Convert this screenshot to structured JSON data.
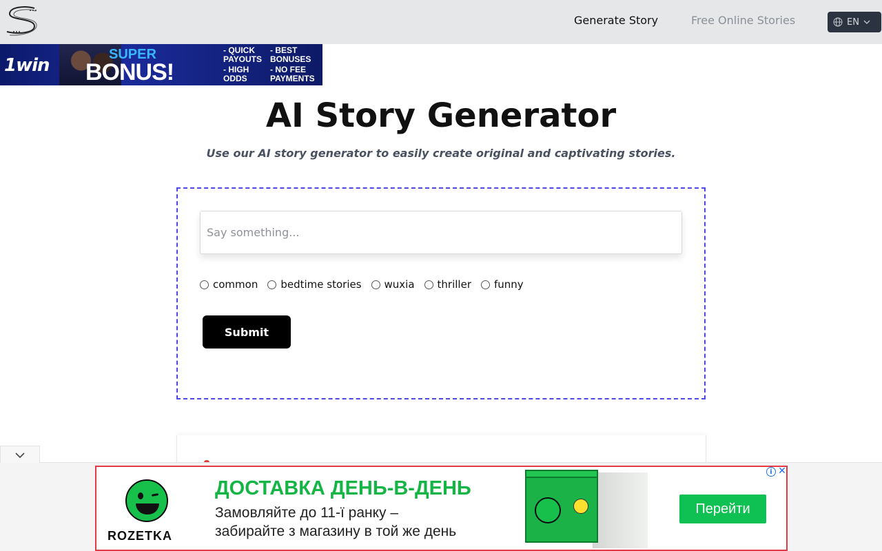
{
  "header": {
    "nav": {
      "generate_story": "Generate Story",
      "free_online_stories": "Free Online Stories"
    },
    "language": "EN"
  },
  "top_ad": {
    "brand": "1win",
    "headline_small": "SUPER",
    "headline_big": "BONUS!",
    "perks": [
      "- QUICK\nPAYOUTS",
      "- BEST\nBONUSES",
      "- HIGH\nODDS",
      "- NO FEE\nPAYMENTS"
    ]
  },
  "hero": {
    "title": "AI Story Generator",
    "subtitle": "Use our AI story generator to easily create original and captivating stories."
  },
  "form": {
    "prompt_placeholder": "Say something...",
    "prompt_value": "",
    "story_types": [
      "common",
      "bedtime stories",
      "wuxia",
      "thriller",
      "funny"
    ],
    "selected_type": null,
    "submit_label": "Submit"
  },
  "bottom_ad": {
    "brand": "ROZETKA",
    "headline": "ДОСТАВКА ДЕНЬ-В-ДЕНЬ",
    "line1": "Замовляйте до 11-ї ранку –",
    "line2": "забирайте з магазину в той же день",
    "cta": "Перейти",
    "info_symbol": "i",
    "close_symbol": "✕"
  },
  "colors": {
    "header_bg": "#e6e7e9",
    "form_border": "#4f46e5",
    "submit_bg": "#000000",
    "ad_green": "#14b545",
    "ad_border": "#e53946"
  }
}
